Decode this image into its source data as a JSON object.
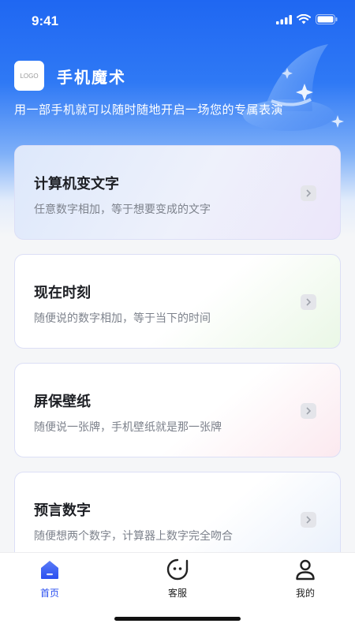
{
  "status": {
    "time": "9:41"
  },
  "header": {
    "logo_text": "LOGO",
    "app_title": "手机魔术",
    "tagline": "用一部手机就可以随时随地开启一场您的专属表演"
  },
  "cards": [
    {
      "title": "计算机变文字",
      "desc": "任意数字相加，等于想要变成的文字"
    },
    {
      "title": "现在时刻",
      "desc": "随便说的数字相加，等于当下的时间"
    },
    {
      "title": "屏保壁纸",
      "desc": "随便说一张牌，手机壁纸就是那一张牌"
    },
    {
      "title": "预言数字",
      "desc": "随便想两个数字，计算器上数字完全吻合"
    }
  ],
  "tabbar": {
    "tabs": [
      {
        "label": "首页",
        "icon": "home-icon",
        "active": true
      },
      {
        "label": "客服",
        "icon": "customer-service-icon",
        "active": false
      },
      {
        "label": "我的",
        "icon": "profile-icon",
        "active": false
      }
    ]
  },
  "colors": {
    "accent": "#2a4ff0",
    "hero": "#1f67f2"
  }
}
